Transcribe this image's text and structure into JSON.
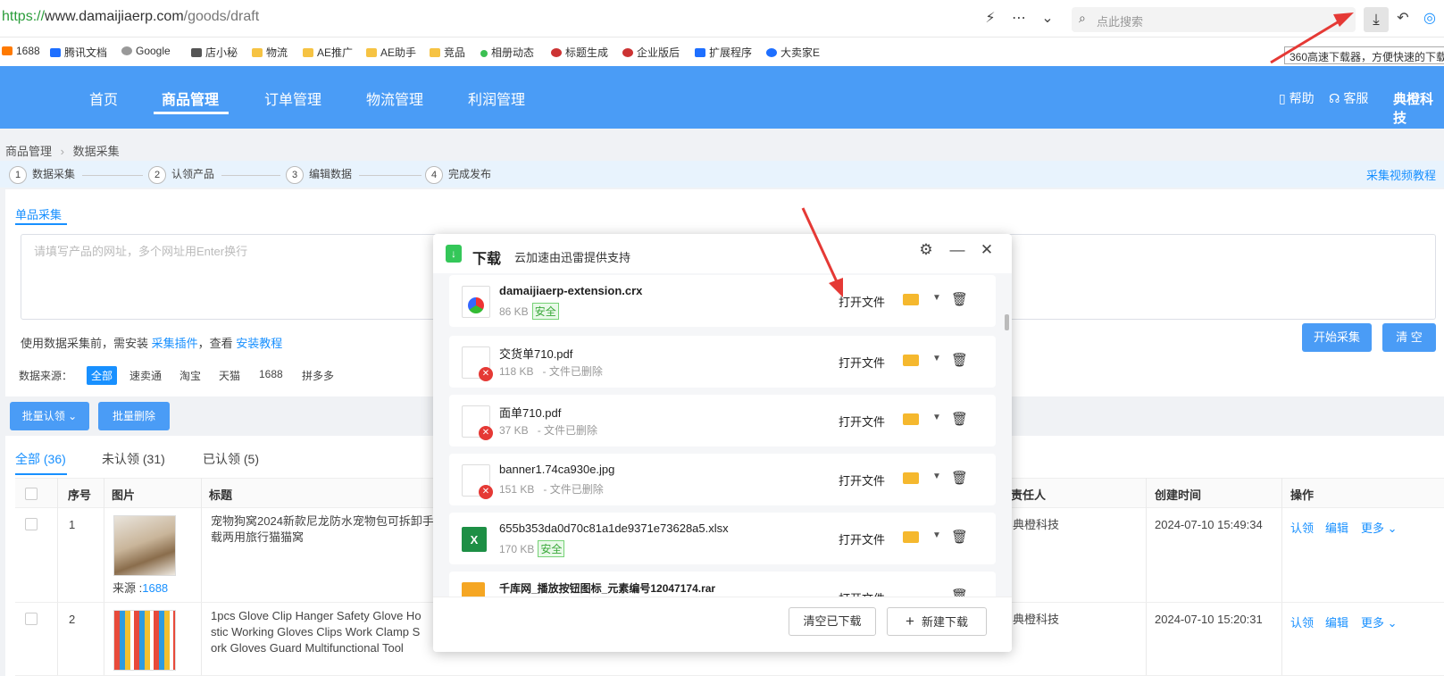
{
  "browser": {
    "url_proto": "https://",
    "url_domain": "www.damaijiaerp.com",
    "url_path": "/goods/draft",
    "search_placeholder": "点此搜索",
    "tooltip": "360高速下载器，方便快速的下载"
  },
  "bookmarks": [
    "1688",
    "腾讯文档",
    "Google",
    "店小秘",
    "物流",
    "AE推广",
    "AE助手",
    "竞品",
    "相册动态",
    "标题生成",
    "企业版后",
    "扩展程序",
    "大卖家E"
  ],
  "nav": {
    "items": [
      "首页",
      "商品管理",
      "订单管理",
      "物流管理",
      "利润管理"
    ],
    "help": "帮助",
    "service": "客服",
    "company": "典橙科技"
  },
  "breadcrumb": {
    "root": "商品管理",
    "current": "数据采集"
  },
  "steps": [
    {
      "num": "1",
      "label": "数据采集"
    },
    {
      "num": "2",
      "label": "认领产品"
    },
    {
      "num": "3",
      "label": "编辑数据"
    },
    {
      "num": "4",
      "label": "完成发布"
    }
  ],
  "tutorial_link": "采集视频教程",
  "collect": {
    "tab": "单品采集",
    "placeholder": "请填写产品的网址，多个网址用Enter换行",
    "hint_prefix": "使用数据采集前，需安装",
    "hint_plugin": "采集插件",
    "hint_mid": "，查看",
    "hint_tutorial": "安装教程",
    "start_button": "开始采集",
    "clear_button": "清 空",
    "source_label": "数据来源：",
    "sources": [
      "全部",
      "速卖通",
      "淘宝",
      "天猫",
      "1688",
      "拼多多"
    ]
  },
  "bulk": {
    "claim": "批量认领",
    "delete": "批量删除"
  },
  "list_tabs": [
    "全部 (36)",
    "未认领 (31)",
    "已认领 (5)"
  ],
  "table": {
    "headers": [
      "序号",
      "图片",
      "标题",
      "责任人",
      "创建时间",
      "操作"
    ],
    "rows": [
      {
        "num": "1",
        "source_prefix": "来源 :",
        "source": "1688",
        "title_l1": "宠物狗窝2024新款尼龙防水宠物包可拆卸手",
        "title_l2": "载两用旅行猫猫窝",
        "owner": "典橙科技",
        "created": "2024-07-10 15:49:34"
      },
      {
        "num": "2",
        "title_l1": "1pcs Glove Clip Hanger Safety Glove Ho",
        "title_l2": "stic Working Gloves Clips Work Clamp S",
        "title_l3": "ork Gloves Guard Multifunctional Tool",
        "owner": "典橙科技",
        "created": "2024-07-10 15:20:31"
      }
    ],
    "actions": [
      "认领",
      "编辑",
      "更多"
    ]
  },
  "download": {
    "title": "下载",
    "subtitle": "云加速由迅雷提供支持",
    "open_label": "打开文件",
    "clear_button": "清空已下载",
    "new_button": "新建下载",
    "items": [
      {
        "name": "damaijiaerp-extension.crx",
        "size": "86 KB",
        "status": "安全"
      },
      {
        "name": "交货单710.pdf",
        "size": "118 KB",
        "status": "- 文件已删除"
      },
      {
        "name": "面单710.pdf",
        "size": "37 KB",
        "status": "- 文件已删除"
      },
      {
        "name": "banner1.74ca930e.jpg",
        "size": "151 KB",
        "status": "- 文件已删除"
      },
      {
        "name": "655b353da0d70c81a1de9371e73628a5.xlsx",
        "size": "170 KB",
        "status": "安全"
      },
      {
        "name": "千库网_播放按钮图标_元素编号12047174.rar",
        "size": "",
        "status": ""
      }
    ]
  }
}
